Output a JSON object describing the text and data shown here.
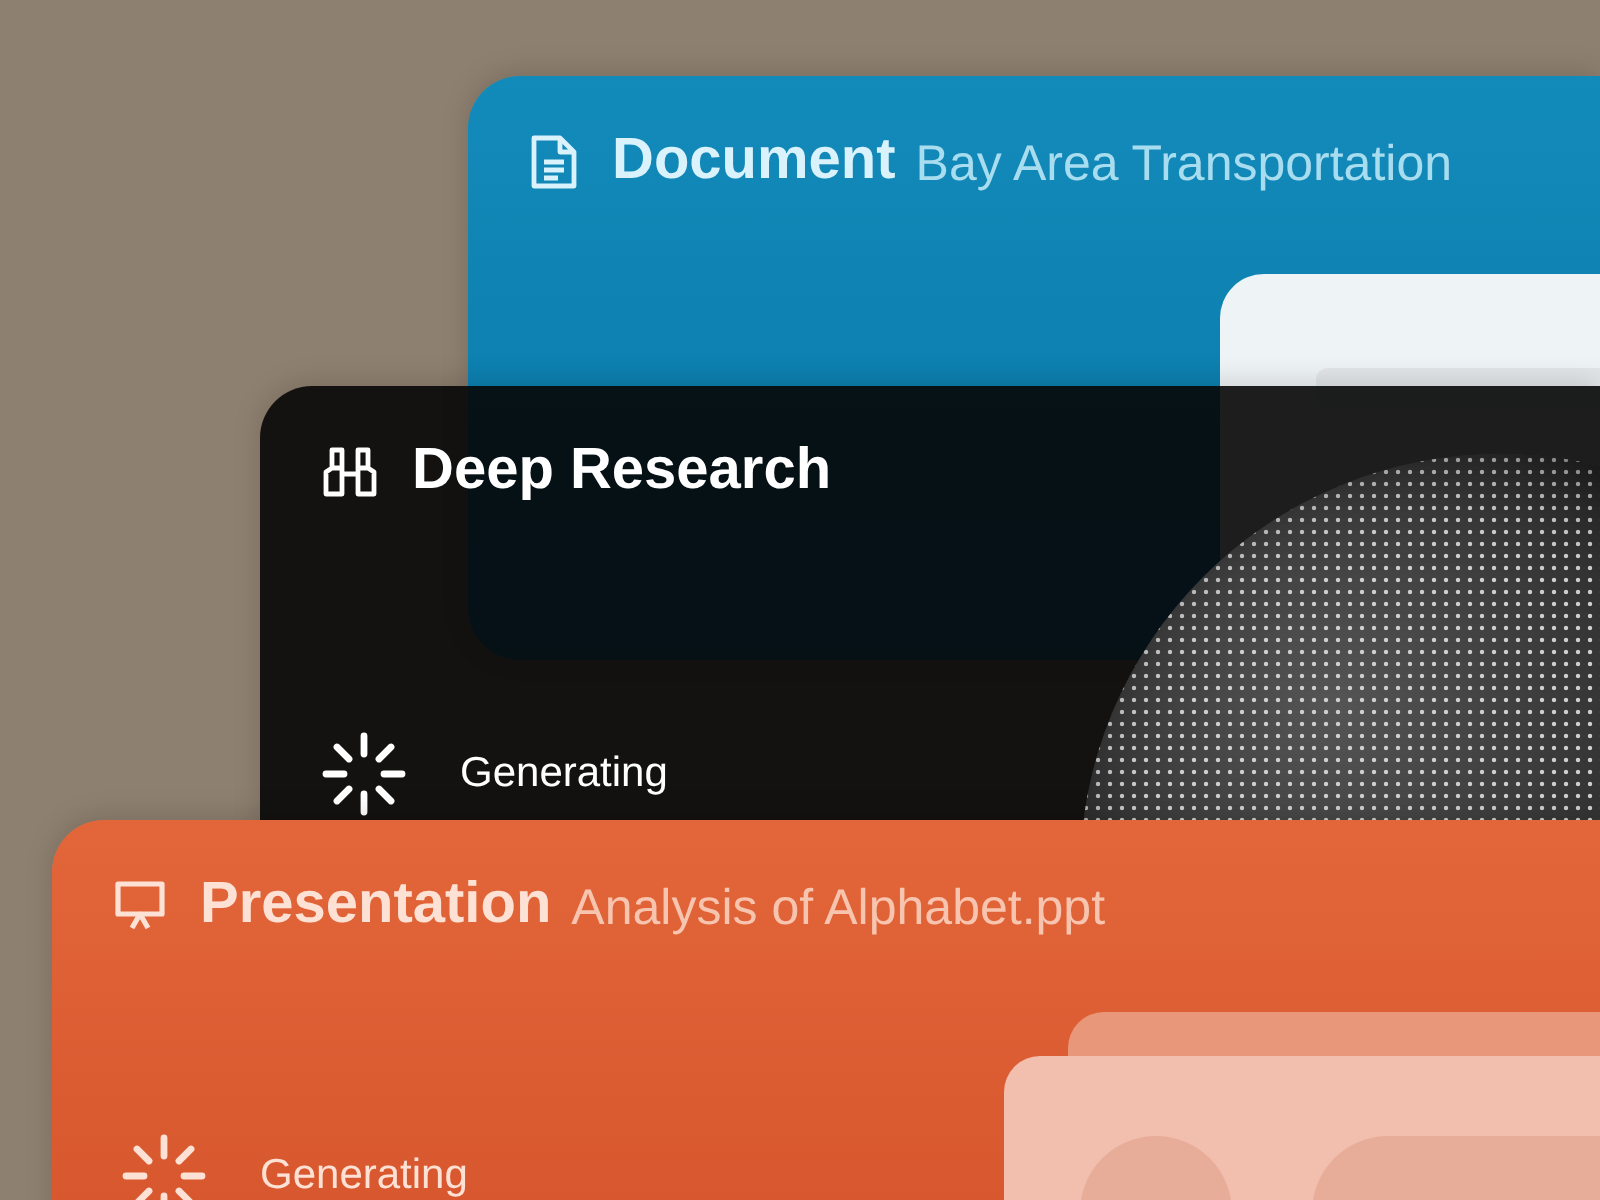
{
  "cards": [
    {
      "kind": "document",
      "title": "Document",
      "subtitle": "Bay Area Transportation"
    },
    {
      "kind": "research",
      "title": "Deep Research",
      "status": "Generating"
    },
    {
      "kind": "presentation",
      "title": "Presentation",
      "subtitle": "Analysis of Alphabet.ppt",
      "status": "Generating"
    }
  ]
}
